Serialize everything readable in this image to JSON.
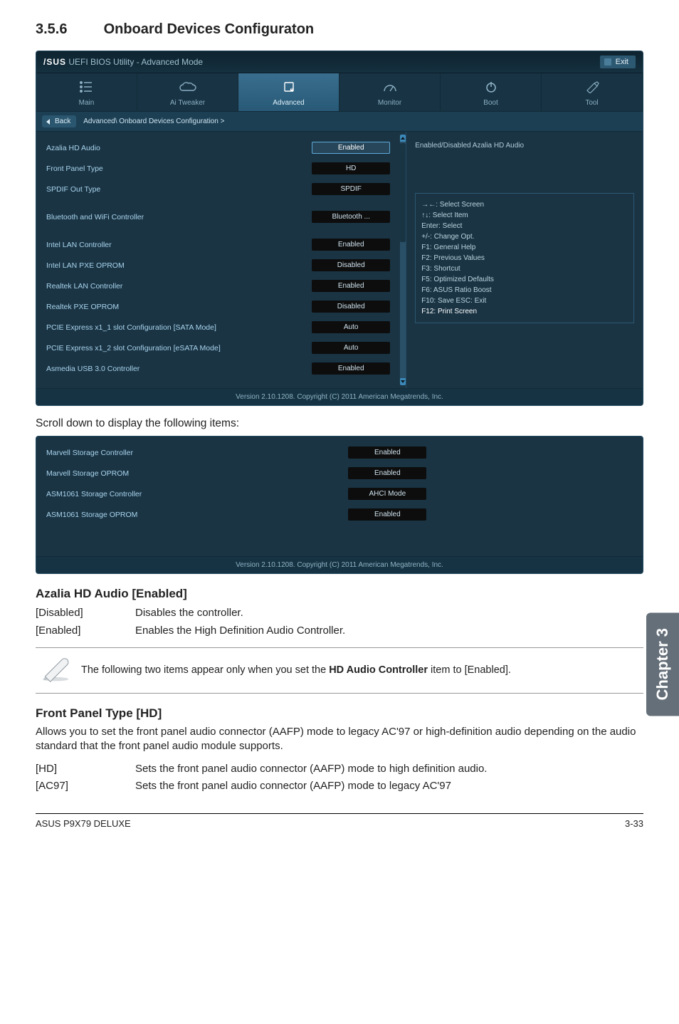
{
  "section": {
    "number": "3.5.6",
    "title": "Onboard Devices Configuraton"
  },
  "bios": {
    "brand_asus": "/SUS",
    "brand_rest": "UEFI BIOS Utility - Advanced Mode",
    "exit": "Exit",
    "tabs": {
      "main": "Main",
      "ai_tweaker": "Ai  Tweaker",
      "advanced": "Advanced",
      "monitor": "Monitor",
      "boot": "Boot",
      "tool": "Tool"
    },
    "back": "Back",
    "breadcrumb": "Advanced\\ Onboard Devices Configuration  >",
    "help_text": "Enabled/Disabled Azalia HD Audio",
    "rows": {
      "azalia": "Azalia HD Audio",
      "front_panel": "Front Panel Type",
      "spdif": "SPDIF Out Type",
      "bt_wifi": "Bluetooth and WiFi Controller",
      "intel_lan": "Intel LAN Controller",
      "intel_pxe": "Intel LAN PXE OPROM",
      "realtek_lan": "Realtek LAN Controller",
      "realtek_pxe": "Realtek PXE OPROM",
      "pcie1": "PCIE Express x1_1 slot Configuration [SATA Mode]",
      "pcie2": "PCIE Express x1_2 slot Configuration [eSATA Mode]",
      "asmedia": "Asmedia USB 3.0 Controller"
    },
    "vals": {
      "azalia": "Enabled",
      "front_panel": "HD",
      "spdif": "SPDIF",
      "bt_wifi": "Bluetooth ...",
      "intel_lan": "Enabled",
      "intel_pxe": "Disabled",
      "realtek_lan": "Enabled",
      "realtek_pxe": "Disabled",
      "pcie1": "Auto",
      "pcie2": "Auto",
      "asmedia": "Enabled"
    },
    "keyhelp": {
      "l1": "→←:  Select Screen",
      "l2": "↑↓:  Select Item",
      "l3": "Enter:  Select",
      "l4": "+/-:  Change Opt.",
      "l5": "F1:  General Help",
      "l6": "F2:  Previous Values",
      "l7": "F3:  Shortcut",
      "l8": "F5:  Optimized Defaults",
      "l9": "F6:  ASUS Ratio Boost",
      "l10": "F10:  Save    ESC:  Exit",
      "l11": "F12:  Print Screen"
    },
    "footer": "Version  2.10.1208.   Copyright  (C)  2011  American  Megatrends,  Inc."
  },
  "caption_scroll": "Scroll down to display the following items:",
  "bios2": {
    "rows": {
      "marvell_ctrl": "Marvell Storage Controller",
      "marvell_oprom": "Marvell Storage OPROM",
      "asm_ctrl": "ASM1061 Storage Controller",
      "asm_oprom": "ASM1061 Storage OPROM"
    },
    "vals": {
      "marvell_ctrl": "Enabled",
      "marvell_oprom": "Enabled",
      "asm_ctrl": "AHCI Mode",
      "asm_oprom": "Enabled"
    }
  },
  "azalia_section": {
    "heading": "Azalia HD Audio [Enabled]",
    "row1_term": "[Disabled]",
    "row1_desc": "Disables the controller.",
    "row2_term": "[Enabled]",
    "row2_desc": "Enables the High Definition Audio Controller."
  },
  "note": {
    "text_pre": "The following two items appear only when you set the ",
    "text_bold": "HD Audio Controller",
    "text_post": " item to [Enabled]."
  },
  "front_panel_section": {
    "heading": "Front Panel Type [HD]",
    "para": "Allows you to set the front panel audio connector (AAFP) mode to legacy AC'97 or high-definition audio depending on the audio standard that the front panel audio module supports.",
    "row1_term": "[HD]",
    "row1_desc": "Sets the front panel audio connector (AAFP) mode to high definition audio.",
    "row2_term": "[AC97]",
    "row2_desc": "Sets the front panel audio connector (AAFP) mode to legacy AC'97"
  },
  "side_tab": "Chapter 3",
  "footer": {
    "left": "ASUS P9X79 DELUXE",
    "right": "3-33"
  }
}
